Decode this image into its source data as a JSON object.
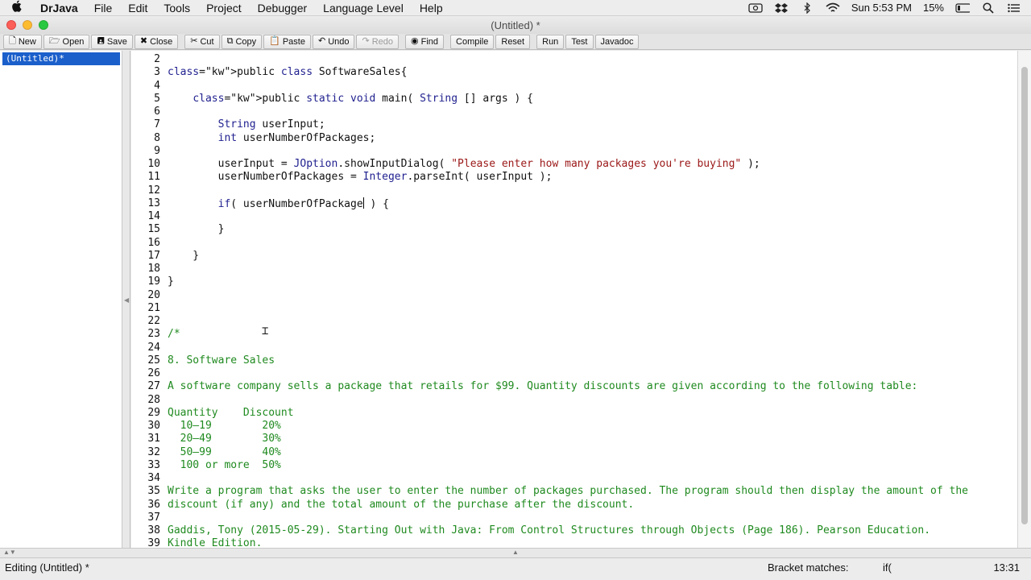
{
  "menubar": {
    "app": "DrJava",
    "items": [
      "File",
      "Edit",
      "Tools",
      "Project",
      "Debugger",
      "Language Level",
      "Help"
    ],
    "clock": "Sun 5:53 PM",
    "battery": "15%"
  },
  "window": {
    "title": "(Untitled) *"
  },
  "toolbar": {
    "new": "New",
    "open": "Open",
    "save": "Save",
    "close": "Close",
    "cut": "Cut",
    "copy": "Copy",
    "paste": "Paste",
    "undo": "Undo",
    "redo": "Redo",
    "find": "Find",
    "compile": "Compile",
    "reset": "Reset",
    "run": "Run",
    "test": "Test",
    "javadoc": "Javadoc"
  },
  "documents": [
    "(Untitled)*"
  ],
  "editor": {
    "lines": [
      {
        "n": "2",
        "text": ""
      },
      {
        "n": "3",
        "text": "public class SoftwareSales{"
      },
      {
        "n": "4",
        "text": ""
      },
      {
        "n": "5",
        "text": "    public static void main( String [] args ) {"
      },
      {
        "n": "6",
        "text": ""
      },
      {
        "n": "7",
        "text": "        String userInput;"
      },
      {
        "n": "8",
        "text": "        int userNumberOfPackages;"
      },
      {
        "n": "9",
        "text": ""
      },
      {
        "n": "10",
        "text": "        userInput = JOption.showInputDialog( \"Please enter how many packages you're buying\" );"
      },
      {
        "n": "11",
        "text": "        userNumberOfPackages = Integer.parseInt( userInput );"
      },
      {
        "n": "12",
        "text": ""
      },
      {
        "n": "13",
        "text": "        if( userNumberOfPackage ) {"
      },
      {
        "n": "14",
        "text": ""
      },
      {
        "n": "15",
        "text": "        }"
      },
      {
        "n": "16",
        "text": ""
      },
      {
        "n": "17",
        "text": "    }"
      },
      {
        "n": "18",
        "text": ""
      },
      {
        "n": "19",
        "text": "}"
      },
      {
        "n": "20",
        "text": ""
      },
      {
        "n": "21",
        "text": ""
      },
      {
        "n": "22",
        "text": ""
      },
      {
        "n": "23",
        "text": "/*"
      },
      {
        "n": "24",
        "text": ""
      },
      {
        "n": "25",
        "text": "8. Software Sales"
      },
      {
        "n": "26",
        "text": ""
      },
      {
        "n": "27",
        "text": "A software company sells a package that retails for $99. Quantity discounts are given according to the following table:"
      },
      {
        "n": "28",
        "text": ""
      },
      {
        "n": "29",
        "text": "Quantity    Discount"
      },
      {
        "n": "30",
        "text": "  10–19        20%"
      },
      {
        "n": "31",
        "text": "  20–49        30%"
      },
      {
        "n": "32",
        "text": "  50–99        40%"
      },
      {
        "n": "33",
        "text": "  100 or more  50%"
      },
      {
        "n": "34",
        "text": ""
      },
      {
        "n": "35",
        "text": "Write a program that asks the user to enter the number of packages purchased. The program should then display the amount of the"
      },
      {
        "n": "36",
        "text": "discount (if any) and the total amount of the purchase after the discount."
      },
      {
        "n": "37",
        "text": ""
      },
      {
        "n": "38",
        "text": "Gaddis, Tony (2015-05-29). Starting Out with Java: From Control Structures through Objects (Page 186). Pearson Education."
      },
      {
        "n": "39",
        "text": "Kindle Edition."
      }
    ]
  },
  "status": {
    "left": "Editing (Untitled) *",
    "bracket_label": "Bracket matches:",
    "bracket_value": "if(",
    "position": "13:31"
  },
  "colors": {
    "keyword": "#1f1f8f",
    "comment": "#1f8a1f",
    "string": "#9b1717",
    "selection": "#1b5fcb"
  }
}
